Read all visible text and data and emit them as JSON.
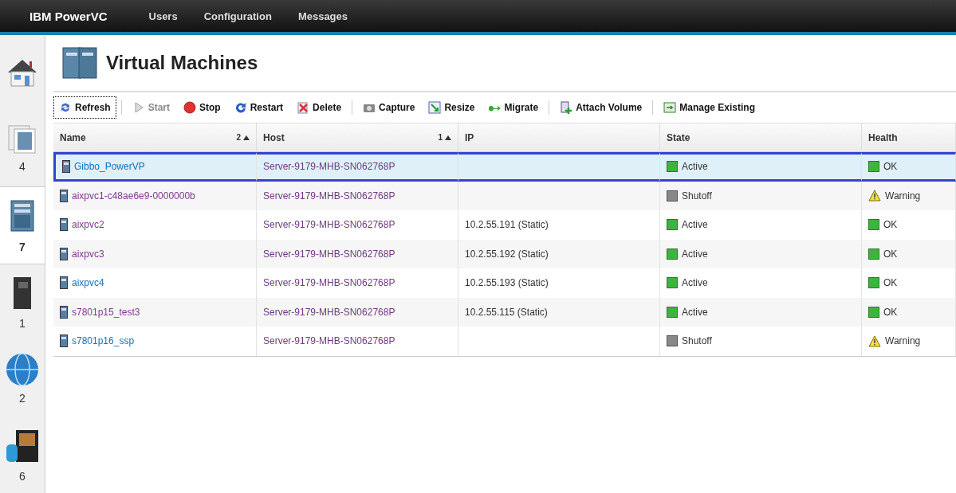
{
  "top_bar": {
    "brand": "IBM PowerVC",
    "menu": [
      "Users",
      "Configuration",
      "Messages"
    ]
  },
  "sidebar": {
    "items": [
      {
        "kind": "home",
        "selected": false
      },
      {
        "kind": "images",
        "count": "4",
        "selected": false
      },
      {
        "kind": "virtual-machines",
        "count": "7",
        "selected": true
      },
      {
        "kind": "hosts",
        "count": "1",
        "selected": false
      },
      {
        "kind": "networks",
        "count": "2",
        "selected": false
      },
      {
        "kind": "storage",
        "count": "6",
        "selected": false
      }
    ]
  },
  "page_title": "Virtual Machines",
  "toolbar": [
    {
      "kind": "refresh",
      "label": "Refresh",
      "disabled": false,
      "focused": true,
      "separator_after": true
    },
    {
      "kind": "start",
      "label": "Start",
      "disabled": true,
      "focused": false,
      "separator_after": false
    },
    {
      "kind": "stop",
      "label": "Stop",
      "disabled": false,
      "focused": false,
      "separator_after": false
    },
    {
      "kind": "restart",
      "label": "Restart",
      "disabled": false,
      "focused": false,
      "separator_after": false
    },
    {
      "kind": "delete",
      "label": "Delete",
      "disabled": false,
      "focused": false,
      "separator_after": true
    },
    {
      "kind": "capture",
      "label": "Capture",
      "disabled": false,
      "focused": false,
      "separator_after": false
    },
    {
      "kind": "resize",
      "label": "Resize",
      "disabled": false,
      "focused": false,
      "separator_after": false
    },
    {
      "kind": "migrate",
      "label": "Migrate",
      "disabled": false,
      "focused": false,
      "separator_after": true
    },
    {
      "kind": "attach",
      "label": "Attach Volume",
      "disabled": false,
      "focused": false,
      "separator_after": true
    },
    {
      "kind": "manage",
      "label": "Manage Existing",
      "disabled": false,
      "focused": false,
      "separator_after": false
    }
  ],
  "table": {
    "columns": [
      {
        "label": "Name",
        "sort_order": "2"
      },
      {
        "label": "Host",
        "sort_order": "1"
      },
      {
        "label": "IP"
      },
      {
        "label": "State"
      },
      {
        "label": "Health"
      }
    ],
    "rows": [
      {
        "name": "Gibbo_PowerVP",
        "visited": false,
        "selected": true,
        "host": "Server-9179-MHB-SN062768P",
        "ip": "",
        "state": {
          "kind": "active",
          "label": "Active"
        },
        "health": {
          "kind": "ok",
          "label": "OK"
        }
      },
      {
        "name": "aixpvc1-c48ae6e9-0000000b",
        "visited": true,
        "selected": false,
        "host": "Server-9179-MHB-SN062768P",
        "ip": "",
        "state": {
          "kind": "shutoff",
          "label": "Shutoff"
        },
        "health": {
          "kind": "warning",
          "label": "Warning"
        }
      },
      {
        "name": "aixpvc2",
        "visited": true,
        "selected": false,
        "host": "Server-9179-MHB-SN062768P",
        "ip": "10.2.55.191 (Static)",
        "state": {
          "kind": "active",
          "label": "Active"
        },
        "health": {
          "kind": "ok",
          "label": "OK"
        }
      },
      {
        "name": "aixpvc3",
        "visited": true,
        "selected": false,
        "host": "Server-9179-MHB-SN062768P",
        "ip": "10.2.55.192 (Static)",
        "state": {
          "kind": "active",
          "label": "Active"
        },
        "health": {
          "kind": "ok",
          "label": "OK"
        }
      },
      {
        "name": "aixpvc4",
        "visited": false,
        "selected": false,
        "host": "Server-9179-MHB-SN062768P",
        "ip": "10.2.55.193 (Static)",
        "state": {
          "kind": "active",
          "label": "Active"
        },
        "health": {
          "kind": "ok",
          "label": "OK"
        }
      },
      {
        "name": "s7801p15_test3",
        "visited": true,
        "selected": false,
        "host": "Server-9179-MHB-SN062768P",
        "ip": "10.2.55.115 (Static)",
        "state": {
          "kind": "active",
          "label": "Active"
        },
        "health": {
          "kind": "ok",
          "label": "OK"
        }
      },
      {
        "name": "s7801p16_ssp",
        "visited": false,
        "selected": false,
        "host": "Server-9179-MHB-SN062768P",
        "ip": "",
        "state": {
          "kind": "shutoff",
          "label": "Shutoff"
        },
        "health": {
          "kind": "warning",
          "label": "Warning"
        }
      }
    ]
  }
}
